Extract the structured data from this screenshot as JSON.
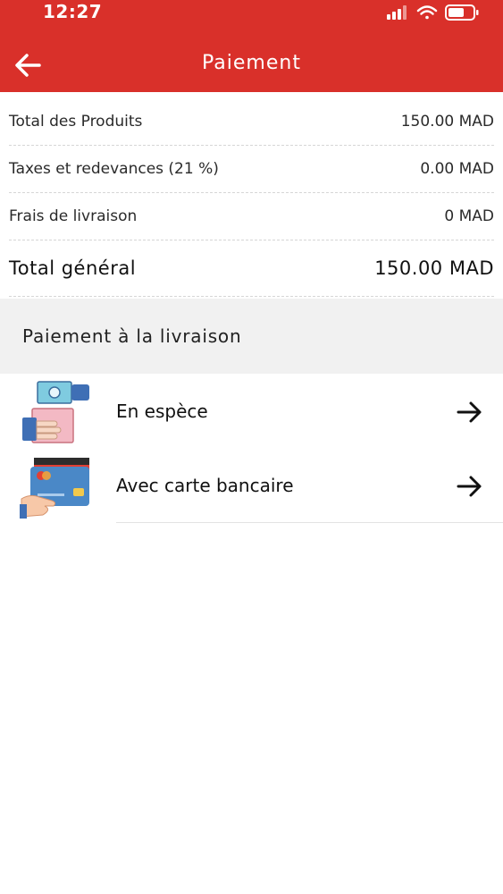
{
  "status_bar": {
    "time": "12:27"
  },
  "header": {
    "title": "Paiement"
  },
  "summary": [
    {
      "label": "Total des Produits",
      "value": "150.00 MAD"
    },
    {
      "label": "Taxes et redevances (21 %)",
      "value": "0.00 MAD"
    },
    {
      "label": "Frais de livraison",
      "value": "0 MAD"
    }
  ],
  "total": {
    "label": "Total général",
    "value": "150.00 MAD"
  },
  "payment_section": {
    "title": "Paiement à la livraison"
  },
  "options": [
    {
      "label": "En espèce",
      "icon": "cash-hand-icon"
    },
    {
      "label": "Avec carte bancaire",
      "icon": "credit-card-icon"
    }
  ],
  "colors": {
    "header": "#d9302a",
    "section_bg": "#f1f1f1"
  }
}
